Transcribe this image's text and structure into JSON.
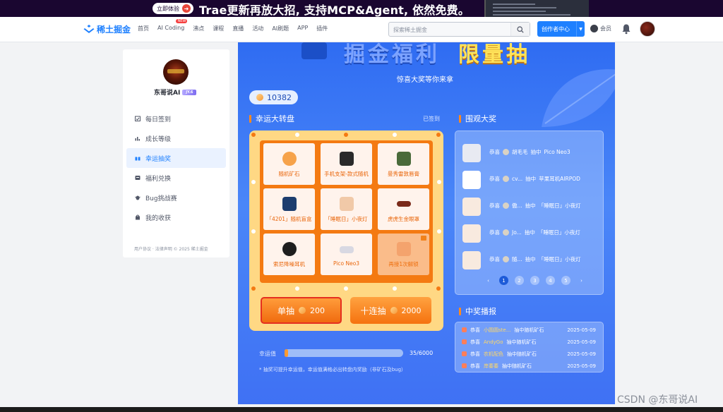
{
  "banner": {
    "cta": "立即体验",
    "text": "Trae更新再放大招, 支持MCP&Agent, 依然免费。"
  },
  "nav": {
    "logo": "稀土掘金",
    "items": [
      "首页",
      "AI Coding",
      "沸点",
      "课程",
      "直播",
      "活动",
      "AI刷题",
      "APP",
      "插件"
    ],
    "new_badge": "NEW",
    "search_placeholder": "探索稀土掘金",
    "create_label": "创作者中心",
    "vip_label": "会员"
  },
  "sidebar": {
    "username": "东哥说AI",
    "badge": "JY.6",
    "menu": [
      {
        "label": "每日签到",
        "icon": "calendar-check-icon"
      },
      {
        "label": "成长等级",
        "icon": "bar-chart-icon"
      },
      {
        "label": "幸运抽奖",
        "icon": "gift-icon",
        "active": true
      },
      {
        "label": "福利兑换",
        "icon": "exchange-icon"
      },
      {
        "label": "Bug挑战赛",
        "icon": "bug-icon"
      },
      {
        "label": "我的收获",
        "icon": "bag-icon"
      }
    ],
    "footer": "用户协议 · 法律声明 © 2025 稀土掘金"
  },
  "main": {
    "title_part1": "掘金福利",
    "title_part2": "限量抽",
    "subtitle": "惊喜大奖等你来拿",
    "points": "10382",
    "wheel_title": "幸运大转盘",
    "signed": "已签到",
    "cells": [
      {
        "label": "随机矿石",
        "icon": "ore-icon",
        "color": "#f6a24a"
      },
      {
        "label": "手机支架-款式随机",
        "icon": "phone-stand-icon",
        "color": "#2a2a2a"
      },
      {
        "label": "曼秀雷敦唇膏",
        "icon": "lip-balm-icon",
        "color": "#4a6a3a"
      },
      {
        "label": "「4201」随机盲盒",
        "icon": "blind-box-icon",
        "color": "#1c3d6e"
      },
      {
        "label": "「睡眠日」小夜灯",
        "icon": "night-light-icon",
        "color": "#f1c9a8"
      },
      {
        "label": "虎虎生金眼罩",
        "icon": "eye-mask-icon",
        "color": "#7a2a1a"
      },
      {
        "label": "索尼降噪耳机",
        "icon": "headphones-icon",
        "color": "#1e1e1e"
      },
      {
        "label": "Pico Neo3",
        "icon": "vr-headset-icon",
        "color": "#e8e8ee"
      },
      {
        "label": "再接1次解锁",
        "icon": "lock-icon",
        "color": "#f5c6b8"
      }
    ],
    "btn_single_label": "单抽",
    "btn_single_cost": "200",
    "btn_ten_label": "十连抽",
    "btn_ten_cost": "2000",
    "luck_label": "幸运值",
    "luck_value": "35/6000",
    "luck_progress": 0.006,
    "luck_note": "* 抽奖可提升幸运值，幸运值满格必出转盘内奖励（非矿石及bug）",
    "winners_title": "围观大奖",
    "winners": [
      {
        "prefix": "恭喜",
        "user": "胡毛毛",
        "verb": "抽中",
        "prize": "Pico Neo3",
        "icon": "vr-headset-icon"
      },
      {
        "prefix": "恭喜",
        "user": "cv...",
        "verb": "抽中",
        "prize": "苹果耳机AIRPOD",
        "icon": "airpods-icon"
      },
      {
        "prefix": "恭喜",
        "user": "傲...",
        "verb": "抽中",
        "prize": "「睡眠日」小夜灯",
        "icon": "night-light-icon"
      },
      {
        "prefix": "恭喜",
        "user": "Jo...",
        "verb": "抽中",
        "prize": "「睡眠日」小夜灯",
        "icon": "night-light-icon"
      },
      {
        "prefix": "恭喜",
        "user": "随...",
        "verb": "抽中",
        "prize": "「睡眠日」小夜灯",
        "icon": "night-light-icon"
      }
    ],
    "pager": [
      "‹",
      "1",
      "2",
      "3",
      "4",
      "5",
      "›"
    ],
    "broadcast_title": "中奖播报",
    "broadcast": [
      {
        "prefix": "恭喜",
        "user": "小圆圆ste...",
        "text": "抽中随机矿石",
        "date": "2025-05-09"
      },
      {
        "prefix": "恭喜",
        "user": "AndyGo",
        "text": "抽中随机矿石",
        "date": "2025-05-09"
      },
      {
        "prefix": "恭喜",
        "user": "农机配色",
        "text": "抽中随机矿石",
        "date": "2025-05-09"
      },
      {
        "prefix": "恭喜",
        "user": "岸蓁蓁",
        "text": "抽中随机矿石",
        "date": "2025-05-09"
      }
    ]
  },
  "watermark": "CSDN @东哥说AI"
}
